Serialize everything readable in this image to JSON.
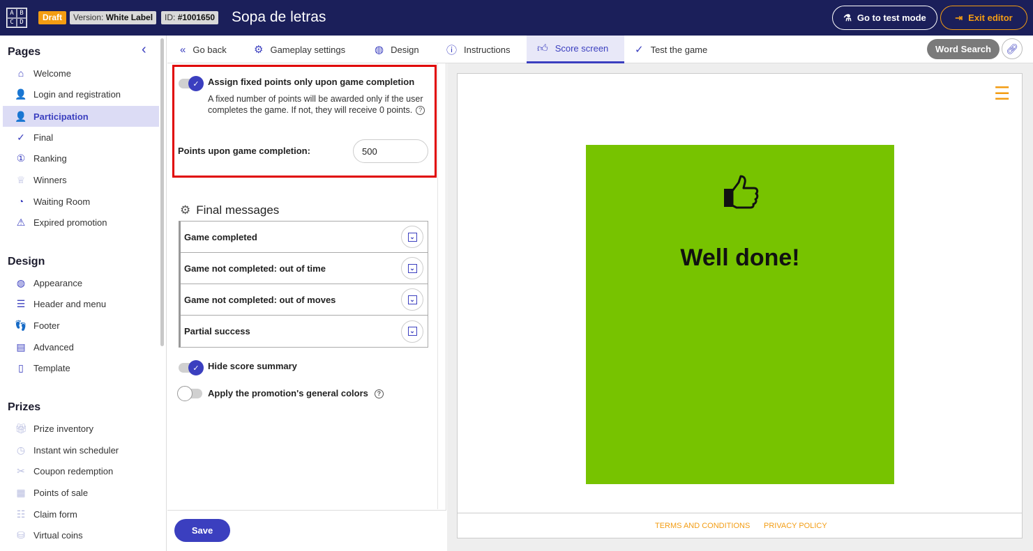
{
  "header": {
    "logo_letters": [
      "A",
      "B",
      "C",
      "D"
    ],
    "draft": "Draft",
    "version_label": "Version:",
    "version_value": "White Label",
    "id_label": "ID:",
    "id_value": "#1001650",
    "title": "Sopa de letras",
    "test_mode": "Go to test mode",
    "exit_editor": "Exit editor"
  },
  "sidebar": {
    "pages_title": "Pages",
    "pages": [
      {
        "label": "Welcome",
        "icon": "home-icon"
      },
      {
        "label": "Login and registration",
        "icon": "user-lock-icon"
      },
      {
        "label": "Participation",
        "icon": "user-search-icon"
      },
      {
        "label": "Final",
        "icon": "check-icon"
      },
      {
        "label": "Ranking",
        "icon": "medal-icon"
      },
      {
        "label": "Winners",
        "icon": "trophy-icon"
      },
      {
        "label": "Waiting Room",
        "icon": "gauge-icon"
      },
      {
        "label": "Expired promotion",
        "icon": "warning-icon"
      }
    ],
    "design_title": "Design",
    "design": [
      {
        "label": "Appearance",
        "icon": "palette-icon"
      },
      {
        "label": "Header and menu",
        "icon": "menu-icon"
      },
      {
        "label": "Footer",
        "icon": "footer-icon"
      },
      {
        "label": "Advanced",
        "icon": "code-icon"
      },
      {
        "label": "Template",
        "icon": "file-icon"
      }
    ],
    "prizes_title": "Prizes",
    "prizes": [
      {
        "label": "Prize inventory",
        "icon": "gift-icon"
      },
      {
        "label": "Instant win scheduler",
        "icon": "clock-icon"
      },
      {
        "label": "Coupon redemption",
        "icon": "coupon-icon"
      },
      {
        "label": "Points of sale",
        "icon": "store-icon"
      },
      {
        "label": "Claim form",
        "icon": "form-icon"
      },
      {
        "label": "Virtual coins",
        "icon": "coins-icon"
      }
    ]
  },
  "tabs": {
    "go_back": "Go back",
    "gameplay": "Gameplay settings",
    "design": "Design",
    "instructions": "Instructions",
    "score": "Score screen",
    "test": "Test the game",
    "game_name": "Word Search"
  },
  "settings": {
    "assign_label": "Assign fixed points only upon game completion",
    "assign_desc": "A fixed number of points will be awarded only if the user completes the game. If not, they will receive 0 points.",
    "points_label": "Points upon game completion:",
    "points_value": "500",
    "final_messages_title": "Final messages",
    "final_messages": [
      "Game completed",
      "Game not completed: out of time",
      "Game not completed: out of moves",
      "Partial success"
    ],
    "hide_summary": "Hide score summary",
    "general_colors": "Apply the promotion's general colors",
    "save": "Save"
  },
  "preview": {
    "message": "Well done!",
    "terms": "TERMS AND CONDITIONS",
    "privacy": "PRIVACY POLICY",
    "bg_color": "#77c300",
    "accent": "#f39c12"
  }
}
